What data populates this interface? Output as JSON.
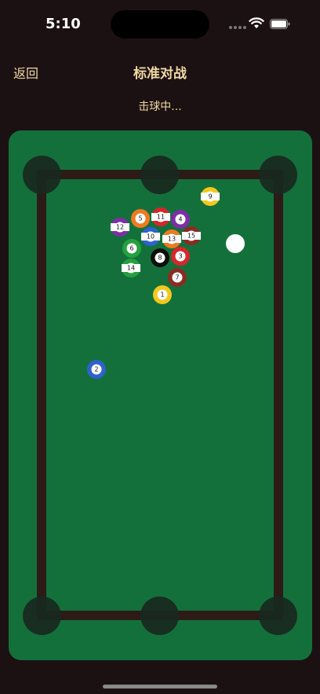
{
  "status_bar": {
    "time": "5:10"
  },
  "nav": {
    "back_label": "返回",
    "title": "标准对战"
  },
  "game": {
    "status_text": "击球中...",
    "balls": [
      {
        "number": "9",
        "color": "#f2c81c",
        "stripe": true
      },
      {
        "number": "5",
        "color": "#ee7a22",
        "stripe": false
      },
      {
        "number": "11",
        "color": "#d7262c",
        "stripe": true
      },
      {
        "number": "4",
        "color": "#7d2fa6",
        "stripe": false
      },
      {
        "number": "12",
        "color": "#7d2fa6",
        "stripe": true
      },
      {
        "number": "10",
        "color": "#2f62cf",
        "stripe": true
      },
      {
        "number": "13",
        "color": "#ee7a22",
        "stripe": true
      },
      {
        "number": "15",
        "color": "#8a2c23",
        "stripe": true
      },
      {
        "number": "6",
        "color": "#25a13f",
        "stripe": false
      },
      {
        "number": "8",
        "color": "#0d0d0d",
        "stripe": false
      },
      {
        "number": "3",
        "color": "#d7262c",
        "stripe": false
      },
      {
        "number": "14",
        "color": "#25a13f",
        "stripe": true
      },
      {
        "number": "7",
        "color": "#8a2c23",
        "stripe": false
      },
      {
        "number": "1",
        "color": "#f2c81c",
        "stripe": false
      },
      {
        "number": "2",
        "color": "#2f62cf",
        "stripe": false
      }
    ]
  }
}
